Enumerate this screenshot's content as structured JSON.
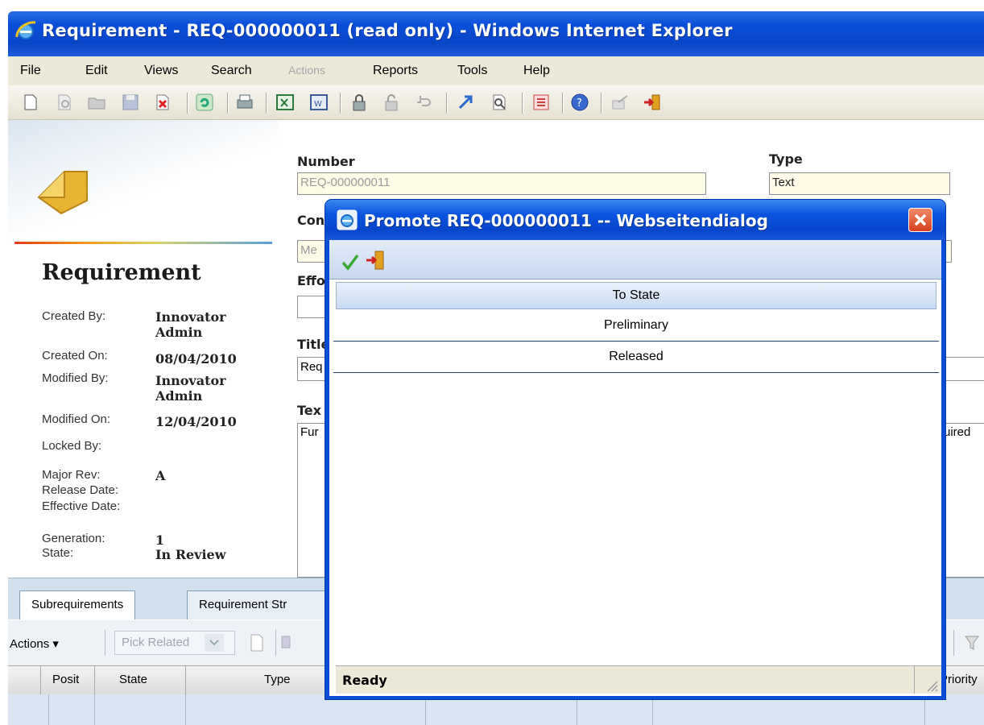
{
  "window": {
    "title": "Requirement - REQ-000000011 (read only) - Windows Internet Explorer"
  },
  "menu": {
    "items": [
      "File",
      "Edit",
      "Views",
      "Search",
      "Actions",
      "Reports",
      "Tools",
      "Help"
    ],
    "disabled": [
      "Actions"
    ]
  },
  "toolbar": {
    "icons": [
      "new-icon",
      "view-icon",
      "open-icon",
      "save-icon",
      "delete-icon",
      "refresh-icon",
      "print-icon",
      "excel-icon",
      "word-icon",
      "lock-icon",
      "unlock-icon",
      "undo-icon",
      "promote-icon",
      "where-used-icon",
      "structure-icon",
      "help-icon",
      "send-icon",
      "exit-icon"
    ]
  },
  "item": {
    "heading": "Requirement",
    "meta": {
      "created_by_label": "Created By:",
      "created_by_value": "Innovator Admin",
      "created_on_label": "Created On:",
      "created_on_value": "08/04/2010",
      "modified_by_label": "Modified By:",
      "modified_by_value": "Innovator Admin",
      "modified_on_label": "Modified On:",
      "modified_on_value": "12/04/2010",
      "locked_by_label": "Locked By:",
      "major_rev_label": "Major Rev:",
      "major_rev_value": "A",
      "release_date_label": "Release Date:",
      "effective_date_label": "Effective Date:",
      "generation_label": "Generation:",
      "generation_value": "1",
      "state_label": "State:",
      "state_value": "In Review"
    }
  },
  "form": {
    "number_label": "Number",
    "number_value": "REQ-000000011",
    "type_label": "Type",
    "type_value": "Text",
    "con_label_partial": "Con",
    "con_value_partial": "Me",
    "effort_label_partial": "Effo",
    "title_label_partial": "Title",
    "title_value_partial": "Req",
    "text_label_partial": "Tex",
    "text_value_partial": "Fur",
    "text_value_right": "uired"
  },
  "tabs": {
    "items": [
      "Subrequirements",
      "Requirement Str"
    ],
    "active": "Subrequirements"
  },
  "grid": {
    "actions_label": "Actions",
    "pick_related_label": "Pick Related",
    "columns": [
      "Posit",
      "State",
      "Type",
      "Priority"
    ]
  },
  "dialog": {
    "title": "Promote REQ-000000011 -- Webseitendialog",
    "column_header": "To State",
    "rows": [
      "Preliminary",
      "Released"
    ],
    "status": "Ready"
  },
  "colors": {
    "titlebar_blue": "#0a4ed8",
    "menubar_bg": "#ece9d8",
    "tabstrip_bg": "#d2e0ec",
    "close_red": "#d6401e"
  }
}
